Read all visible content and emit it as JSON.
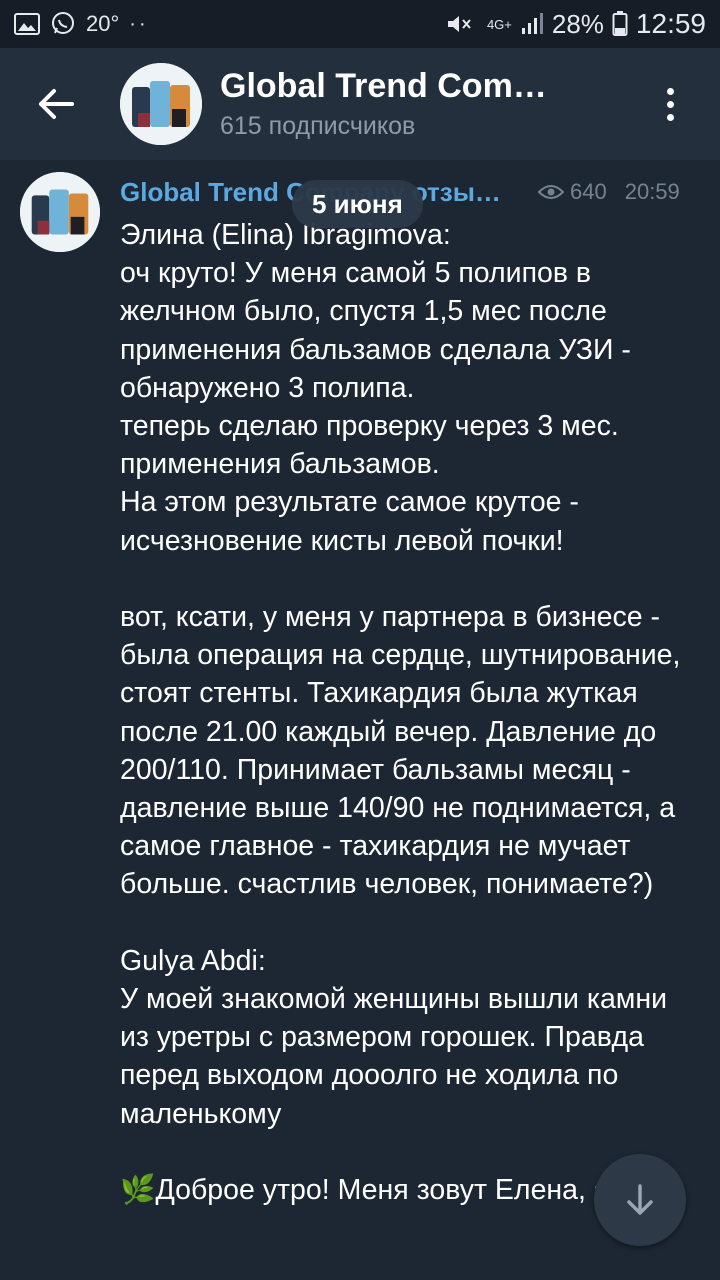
{
  "status_bar": {
    "temperature": "20°",
    "network": "4G+",
    "battery": "28%",
    "time": "12:59",
    "icons": [
      "gallery-icon",
      "whatsapp-icon",
      "dots-icon",
      "mute-icon",
      "signal-icon",
      "battery-icon"
    ]
  },
  "header": {
    "title": "Global Trend Comp…",
    "subtitle": "615 подписчиков"
  },
  "post": {
    "author": "Global Trend Company отзы…",
    "views": "640",
    "time": "20:59",
    "date_pill": "5 июня",
    "text": "Элина (Elina) Ibragimova:\nоч круто! У меня самой 5 полипов в желчном было, спустя 1,5 мес после применения бальзамов сделала УЗИ - обнаружено 3 полипа.\nтеперь сделаю проверку через 3 мес. применения бальзамов.\nНа этом результате самое крутое - исчезновение кисты левой почки!\n\nвот, ксати, у меня у партнера в бизнесе - была операция на сердце, шутнирование, стоят стенты. Тахикардия была жуткая после 21.00 каждый вечер. Давление до 200/110. Принимает бальзамы месяц - давление выше 140/90 не поднимается, а самое главное - тахикардия не мучает больше. счастлив человек, понимаете?)\n\nGulya Abdi:\nУ моей знакомой женщины вышли камни из уретры с размером горошек. Правда перед выходом дооолго не ходила по маленькому\n\n🌿Доброе утро! Меня зовут Елена, я"
  },
  "colors": {
    "background": "#1d2733",
    "header": "#232f3d",
    "status_bar": "#161d26",
    "author": "#5ca8e0",
    "meta": "#76838f",
    "subtitle": "#8e9ba8"
  }
}
